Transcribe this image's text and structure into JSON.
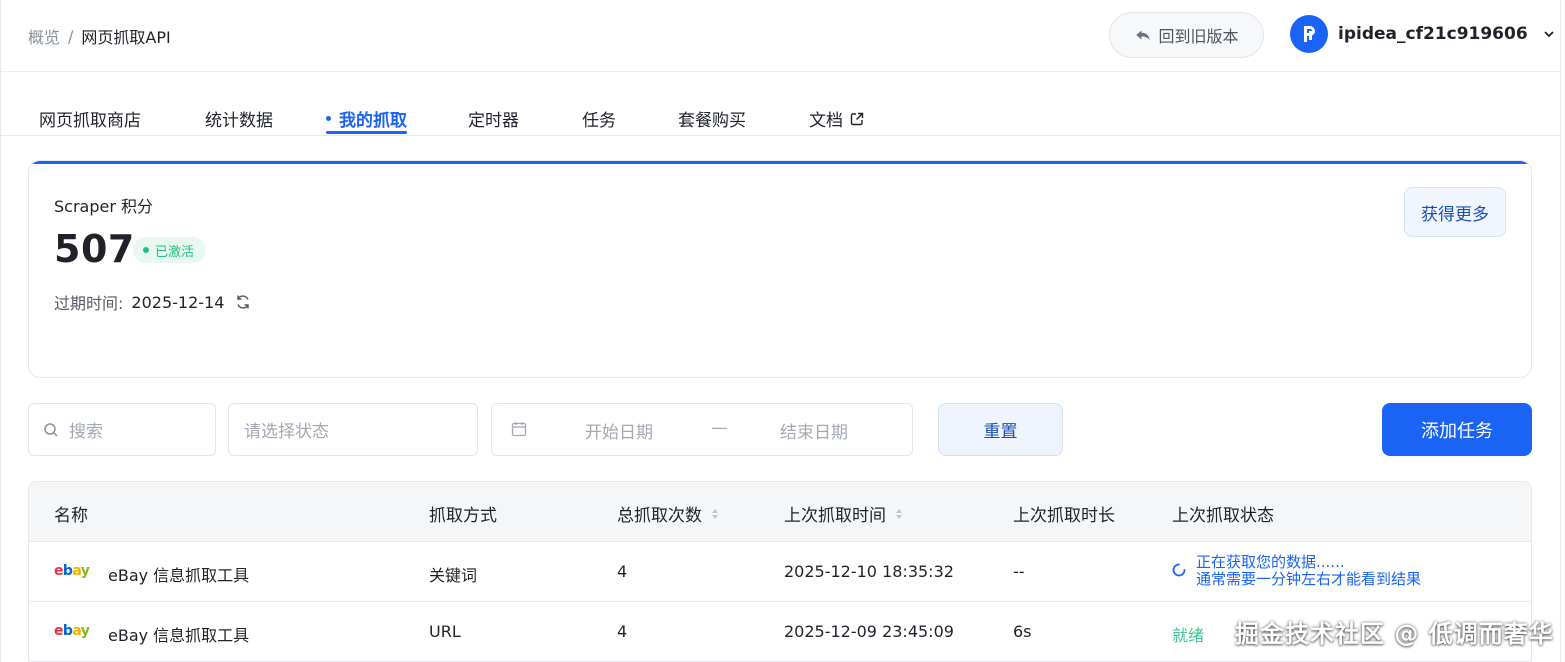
{
  "breadcrumb": {
    "root": "概览",
    "separator": "/",
    "current": "网页抓取API"
  },
  "header": {
    "back_button": "回到旧版本",
    "username": "ipidea_cf21c919606"
  },
  "tabs": [
    {
      "label": "网页抓取商店",
      "active": false
    },
    {
      "label": "统计数据",
      "active": false
    },
    {
      "label": "我的抓取",
      "active": true
    },
    {
      "label": "定时器",
      "active": false
    },
    {
      "label": "任务",
      "active": false
    },
    {
      "label": "套餐购买",
      "active": false
    },
    {
      "label": "文档",
      "active": false
    }
  ],
  "credits": {
    "title": "Scraper 积分",
    "value": "507",
    "badge": "已激活",
    "expire_label": "过期时间:",
    "expire_value": "2025-12-14",
    "more_button": "获得更多"
  },
  "filters": {
    "search_placeholder": "搜索",
    "status_placeholder": "请选择状态",
    "start_date_placeholder": "开始日期",
    "date_separator": "—",
    "end_date_placeholder": "结束日期",
    "reset_button": "重置",
    "add_button": "添加任务"
  },
  "table": {
    "columns": [
      "名称",
      "抓取方式",
      "总抓取次数",
      "上次抓取时间",
      "上次抓取时长",
      "上次抓取状态"
    ],
    "rows": [
      {
        "logo": "ebay",
        "name": "eBay 信息抓取工具",
        "method": "关键词",
        "count": "4",
        "last_time": "2025-12-10 18:35:32",
        "duration": "--",
        "status_line1": "正在获取您的数据......",
        "status_line2": "通常需要一分钟左右才能看到结果"
      },
      {
        "logo": "ebay",
        "name": "eBay 信息抓取工具",
        "method": "URL",
        "count": "4",
        "last_time": "2025-12-09 23:45:09",
        "duration": "6s",
        "status": "就绪"
      }
    ]
  },
  "watermark": "掘金技术社区 @ 低调而奢华",
  "colors": {
    "primary": "#1a63f5",
    "success": "#1fbf83",
    "ebay_red": "#e53238",
    "ebay_blue": "#0064d2",
    "ebay_yellow": "#f5af02",
    "ebay_green": "#86b817"
  }
}
